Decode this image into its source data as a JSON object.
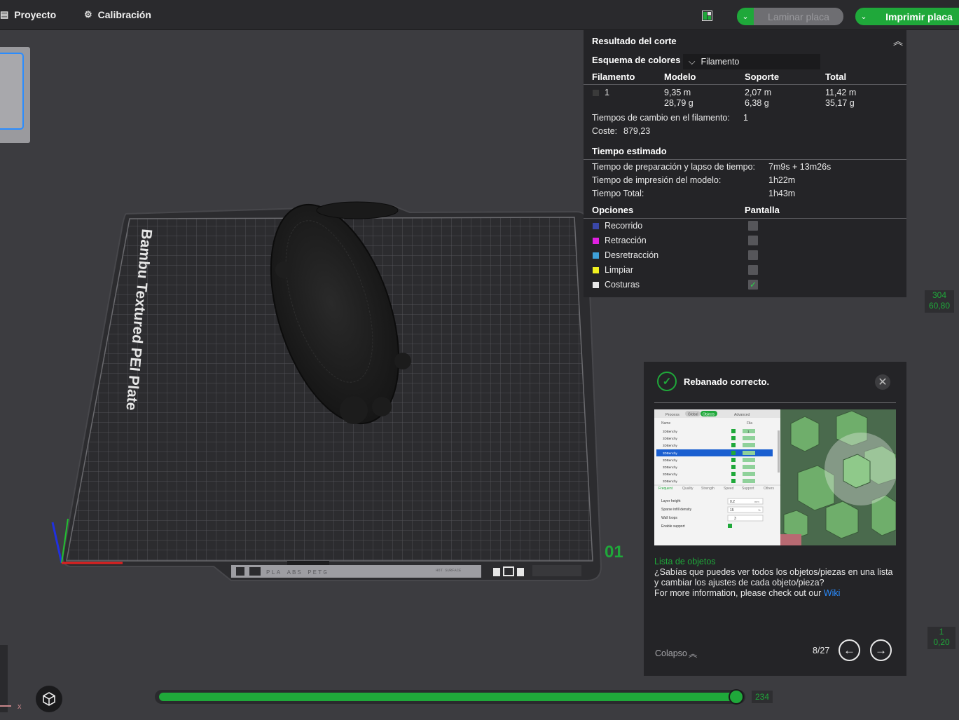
{
  "topbar": {
    "tab_project": "Proyecto",
    "tab_calibration": "Calibración",
    "slice_button": "Laminar placa",
    "print_button": "Imprimir placa"
  },
  "plate": {
    "name": "Bambu Textured PEI Plate",
    "number": "01",
    "strip_text": "PLA ABS PETG",
    "strip_text2": "HOT SURFACE"
  },
  "slice_result": {
    "title": "Resultado del corte",
    "color_scheme_label": "Esquema de colores",
    "color_scheme_value": "Filamento",
    "columns": [
      "Filamento",
      "Modelo",
      "Soporte",
      "Total"
    ],
    "rows": [
      {
        "filament": "1",
        "model_len": "9,35 m",
        "model_weight": "28,79 g",
        "support_len": "2,07 m",
        "support_weight": "6,38 g",
        "total_len": "11,42 m",
        "total_weight": "35,17 g",
        "color": "#2e2e2e"
      }
    ],
    "filament_changes_label": "Tiempos de cambio en el filamento:",
    "filament_changes_value": "1",
    "cost_label": "Coste:",
    "cost_value": "879,23",
    "estimated_time_title": "Tiempo estimado",
    "times": [
      {
        "label": "Tiempo de preparación y lapso de tiempo:",
        "value": "7m9s + 13m26s"
      },
      {
        "label": "Tiempo de impresión del modelo:",
        "value": "1h22m"
      },
      {
        "label": "Tiempo Total:",
        "value": "1h43m"
      }
    ],
    "options_title": "Opciones",
    "display_title": "Pantalla",
    "options": [
      {
        "label": "Recorrido",
        "color": "#3a47a8",
        "checked": false
      },
      {
        "label": "Retracción",
        "color": "#e020e0",
        "checked": false
      },
      {
        "label": "Desretracción",
        "color": "#3ea0d8",
        "checked": false
      },
      {
        "label": "Limpiar",
        "color": "#f0f020",
        "checked": false
      },
      {
        "label": "Costuras",
        "color": "#e8e8e8",
        "checked": true
      }
    ]
  },
  "layer_slider": {
    "top_value": "304",
    "top_height": "60,80",
    "bottom_value": "1",
    "bottom_height": "0,20",
    "move_value": "234"
  },
  "notification": {
    "title": "Rebanado correcto.",
    "link_title": "Lista de objetos",
    "body": "¿Sabías que puedes ver todos los objetos/piezas en una lista y cambiar los ajustes de cada objeto/pieza?",
    "more_info": "For more information, please check out our",
    "wiki_link": "Wiki",
    "collapse": "Colapso",
    "page": "8/27",
    "thumb": {
      "tabs": [
        "Process",
        "Global",
        "Objects"
      ],
      "advanced": "Advanced",
      "col_name": "Name",
      "col_fila": "Fila",
      "items": [
        "3DBenchy",
        "3DBenchy",
        "3DBenchy",
        "3DBenchy",
        "3DBenchy",
        "3DBenchy",
        "3DBenchy",
        "3DBenchy"
      ],
      "item_value": "1",
      "settings_tabs": [
        "Frequent",
        "Quality",
        "Strength",
        "Speed",
        "Support",
        "Others"
      ],
      "settings": [
        {
          "label": "Layer height",
          "value": "0.2",
          "unit": "mm"
        },
        {
          "label": "Sparse infill density",
          "value": "15",
          "unit": "%"
        },
        {
          "label": "Wall loops",
          "value": "3",
          "unit": ""
        },
        {
          "label": "Enable support",
          "value": "",
          "unit": ""
        }
      ]
    }
  },
  "axis": {
    "x_label": "x"
  },
  "colors": {
    "accent": "#1fa83a",
    "panel": "#242427",
    "background": "#3c3c40",
    "link": "#2a8cff"
  }
}
